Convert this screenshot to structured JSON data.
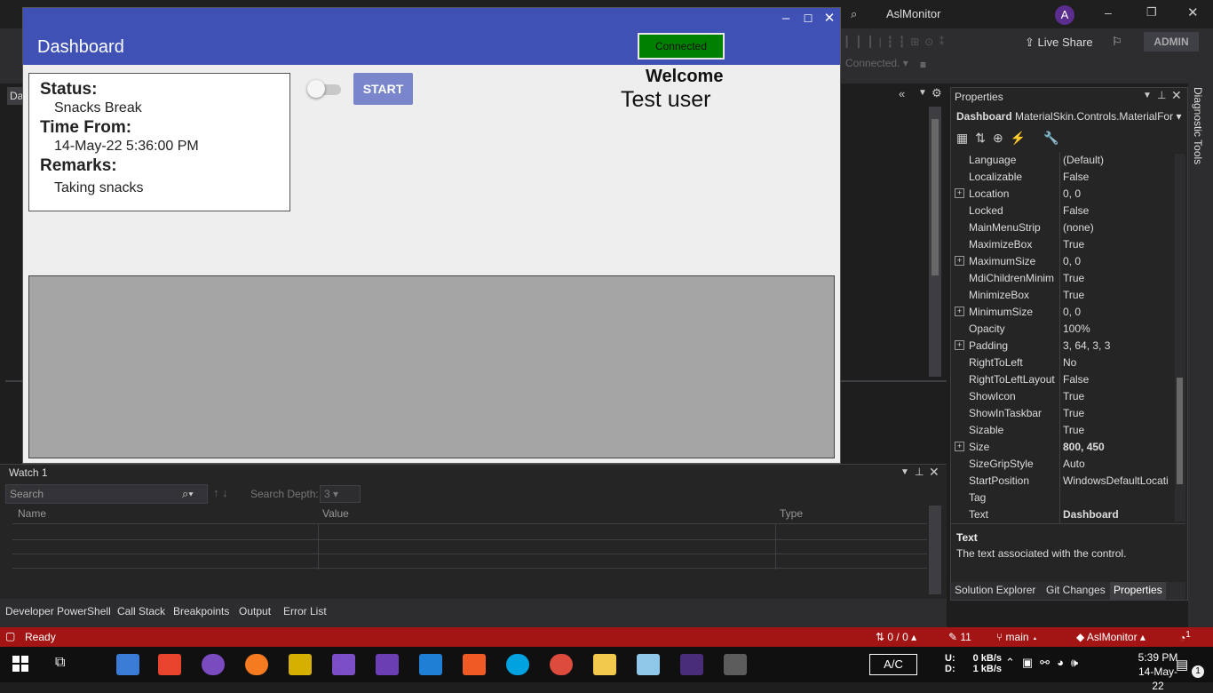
{
  "vs": {
    "window_title": "AslMonitor",
    "user_initial": "A",
    "live_share": "Live Share",
    "admin": "ADMIN",
    "connected_dropdown": "Connected.",
    "editor_tab_fragment": "Da",
    "watch": {
      "title": "Watch 1",
      "search_placeholder": "Search",
      "search_depth_label": "Search Depth:",
      "search_depth_value": "3",
      "columns": [
        "Name",
        "Value",
        "Type"
      ]
    },
    "bottom_tabs": [
      "Developer PowerShell",
      "Call Stack",
      "Breakpoints",
      "Output",
      "Error List"
    ],
    "status": {
      "ready": "Ready",
      "changes": "0 / 0",
      "pencil_count": "11",
      "branch": "main",
      "repo": "AslMonitor",
      "notifications": "1"
    },
    "diagnostic_tools": "Diagnostic Tools"
  },
  "properties": {
    "title": "Properties",
    "object": "Dashboard",
    "object_type": "MaterialSkin.Controls.MaterialFor",
    "rows": [
      {
        "k": "Language",
        "v": "(Default)",
        "plus": false,
        "bold": false
      },
      {
        "k": "Localizable",
        "v": "False",
        "plus": false,
        "bold": false
      },
      {
        "k": "Location",
        "v": "0, 0",
        "plus": true,
        "bold": false
      },
      {
        "k": "Locked",
        "v": "False",
        "plus": false,
        "bold": false
      },
      {
        "k": "MainMenuStrip",
        "v": "(none)",
        "plus": false,
        "bold": false
      },
      {
        "k": "MaximizeBox",
        "v": "True",
        "plus": false,
        "bold": false
      },
      {
        "k": "MaximumSize",
        "v": "0, 0",
        "plus": true,
        "bold": false
      },
      {
        "k": "MdiChildrenMinim",
        "v": "True",
        "plus": false,
        "bold": false
      },
      {
        "k": "MinimizeBox",
        "v": "True",
        "plus": false,
        "bold": false
      },
      {
        "k": "MinimumSize",
        "v": "0, 0",
        "plus": true,
        "bold": false
      },
      {
        "k": "Opacity",
        "v": "100%",
        "plus": false,
        "bold": false
      },
      {
        "k": "Padding",
        "v": "3, 64, 3, 3",
        "plus": true,
        "bold": false
      },
      {
        "k": "RightToLeft",
        "v": "No",
        "plus": false,
        "bold": false
      },
      {
        "k": "RightToLeftLayout",
        "v": "False",
        "plus": false,
        "bold": false
      },
      {
        "k": "ShowIcon",
        "v": "True",
        "plus": false,
        "bold": false
      },
      {
        "k": "ShowInTaskbar",
        "v": "True",
        "plus": false,
        "bold": false
      },
      {
        "k": "Sizable",
        "v": "True",
        "plus": false,
        "bold": false
      },
      {
        "k": "Size",
        "v": "800, 450",
        "plus": true,
        "bold": true
      },
      {
        "k": "SizeGripStyle",
        "v": "Auto",
        "plus": false,
        "bold": false
      },
      {
        "k": "StartPosition",
        "v": "WindowsDefaultLocati",
        "plus": false,
        "bold": false
      },
      {
        "k": "Tag",
        "v": "",
        "plus": false,
        "bold": false
      },
      {
        "k": "Text",
        "v": "Dashboard",
        "plus": false,
        "bold": true
      }
    ],
    "desc_title": "Text",
    "desc_text": "The text associated with the control.",
    "tabs": [
      "Solution Explorer",
      "Git Changes",
      "Properties"
    ]
  },
  "dashboard": {
    "title": "Dashboard",
    "connected": "Connected",
    "start": "START",
    "welcome": "Welcome",
    "user": "Test user",
    "status_label": "Status:",
    "status_value": "Snacks Break",
    "time_label": "Time From:",
    "time_value": "14-May-22 5:36:00 PM",
    "remarks_label": "Remarks:",
    "remarks_value": "Taking snacks",
    "toggle_on": false
  },
  "taskbar": {
    "ac": "A/C",
    "net_up_label": "U:",
    "net_down_label": "D:",
    "net_up": "0 kB/s",
    "net_down": "1 kB/s",
    "time": "5:39 PM",
    "date": "14-May-22",
    "notif_count": "1"
  },
  "colors": {
    "material_primary": "#3f51b5",
    "start_button": "#7986cb",
    "connected_green": "#008000",
    "status_bar": "#a31515"
  }
}
